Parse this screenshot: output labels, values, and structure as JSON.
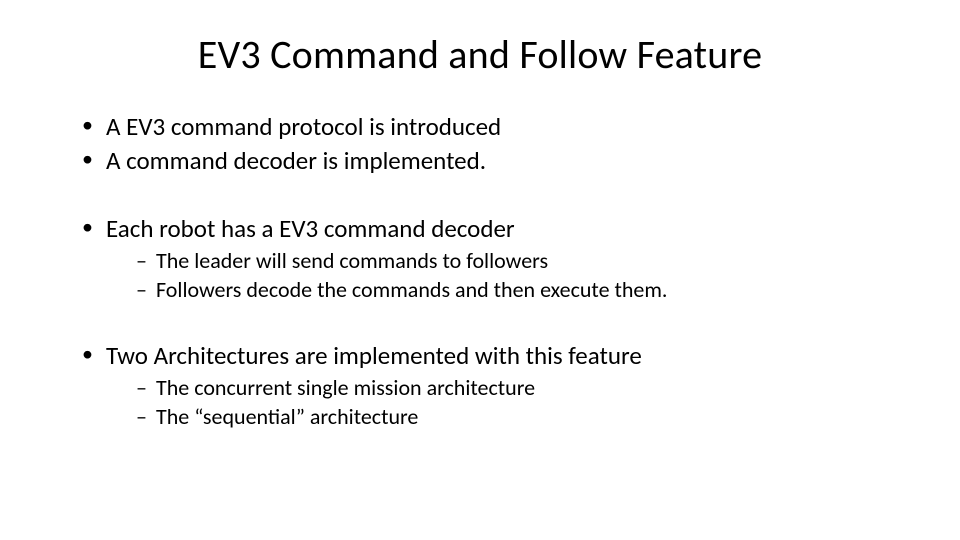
{
  "title": "EV3 Command and Follow Feature",
  "bullets": {
    "b1": "A EV3 command protocol is introduced",
    "b2": "A command decoder is implemented.",
    "b3": "Each robot has a EV3 command decoder",
    "b3_sub1": "The leader will send commands to followers",
    "b3_sub2": "Followers decode the commands and then execute them.",
    "b4": "Two Architectures are implemented with this feature",
    "b4_sub1": "The concurrent single mission architecture",
    "b4_sub2": "The “sequential” architecture"
  }
}
